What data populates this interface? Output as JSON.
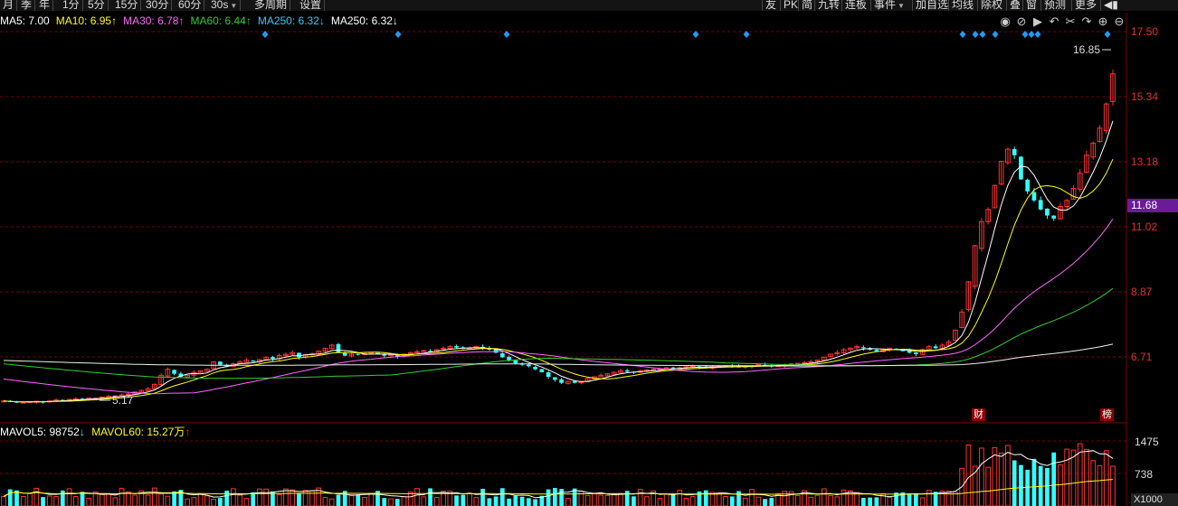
{
  "toolbar": {
    "left": [
      {
        "id": "month",
        "label": "月"
      },
      {
        "id": "quarter",
        "label": "季"
      },
      {
        "id": "year",
        "label": "年"
      },
      {
        "id": "1min",
        "label": "1分"
      },
      {
        "id": "5min",
        "label": "5分"
      },
      {
        "id": "15min",
        "label": "15分"
      },
      {
        "id": "30min",
        "label": "30分"
      },
      {
        "id": "60min",
        "label": "60分"
      },
      {
        "id": "30s",
        "label": "30s"
      },
      {
        "id": "multi-period",
        "label": "多周期"
      },
      {
        "id": "settings",
        "label": "设置"
      }
    ],
    "right": [
      {
        "id": "friend",
        "label": "友"
      },
      {
        "id": "pk",
        "label": "PK"
      },
      {
        "id": "shang",
        "label": "简"
      },
      {
        "id": "jiuzhuan",
        "label": "九转"
      },
      {
        "id": "lianban",
        "label": "连板"
      },
      {
        "id": "event",
        "label": "事件"
      },
      {
        "id": "add-watch",
        "label": "加自选"
      },
      {
        "id": "junxian",
        "label": "均线"
      },
      {
        "id": "fuquan",
        "label": "除权"
      },
      {
        "id": "dieja",
        "label": "叠"
      },
      {
        "id": "window",
        "label": "窗"
      },
      {
        "id": "forecast",
        "label": "预测"
      },
      {
        "id": "more",
        "label": "更多"
      }
    ]
  },
  "ma_legend": [
    {
      "label": "MA5: 7.00",
      "arrow": "",
      "color": "#ffffff"
    },
    {
      "label": "MA10: 6.95",
      "arrow": "↑",
      "color": "#ffff00"
    },
    {
      "label": "MA30: 6.78",
      "arrow": "↑",
      "color": "#ff66ff"
    },
    {
      "label": "MA60: 6.44",
      "arrow": "↑",
      "color": "#33cc33"
    },
    {
      "label": "MA250: 6.32",
      "arrow": "↓",
      "color": "#33ccff"
    },
    {
      "label": "MA250: 6.32",
      "arrow": "↓",
      "color": "#ffffff"
    }
  ],
  "toolbar_icons": [
    "eye-icon",
    "eye-slash-icon",
    "play-icon",
    "undo-icon",
    "scissors-icon",
    "redo-icon",
    "zoom-in-icon",
    "zoom-out-icon"
  ],
  "price_axis": [
    "17.50",
    "15.34",
    "13.18",
    "11.02",
    "8.87",
    "6.71"
  ],
  "current_price": "11.68",
  "high_label": "16.85",
  "low_label": "5.17",
  "markers": {
    "cai": "财",
    "bang": "榜"
  },
  "vol_legend": {
    "mavol5": "MAVOL5: 98752",
    "mavol5_arrow": "↓",
    "mavol60": "MAVOL60: 15.27万",
    "mavol60_arrow": "↑"
  },
  "vol_axis": [
    "1475",
    "738"
  ],
  "vol_unit": "X1000",
  "colors": {
    "up": "#ff3333",
    "down": "#33ffff",
    "grid": "#7a0000",
    "bg": "#000000"
  },
  "chart_data": {
    "type": "candlestick",
    "ylim": [
      4.9,
      17.9
    ],
    "ticks": [
      17.5,
      15.34,
      13.18,
      11.02,
      8.87,
      6.71
    ],
    "closes": [
      5.25,
      5.22,
      5.2,
      5.21,
      5.23,
      5.24,
      5.22,
      5.25,
      5.28,
      5.27,
      5.3,
      5.32,
      5.3,
      5.35,
      5.34,
      5.38,
      5.4,
      5.42,
      5.45,
      5.48,
      5.55,
      5.6,
      5.65,
      5.8,
      6.1,
      6.3,
      6.15,
      6.05,
      6.1,
      6.2,
      6.25,
      6.3,
      6.55,
      6.45,
      6.4,
      6.48,
      6.55,
      6.6,
      6.55,
      6.62,
      6.7,
      6.65,
      6.75,
      6.8,
      6.85,
      6.7,
      6.78,
      6.82,
      6.9,
      7.0,
      7.1,
      6.85,
      6.75,
      6.8,
      6.78,
      6.82,
      6.85,
      6.8,
      6.75,
      6.78,
      6.72,
      6.8,
      6.85,
      6.88,
      6.92,
      6.9,
      6.95,
      7.0,
      7.05,
      7.02,
      6.98,
      7.0,
      7.05,
      7.0,
      6.95,
      6.85,
      6.7,
      6.6,
      6.5,
      6.45,
      6.4,
      6.3,
      6.2,
      6.05,
      5.95,
      5.85,
      5.9,
      5.85,
      5.9,
      6.0,
      6.05,
      6.1,
      6.15,
      6.2,
      6.25,
      6.22,
      6.2,
      6.25,
      6.28,
      6.3,
      6.32,
      6.35,
      6.33,
      6.35,
      6.38,
      6.4,
      6.37,
      6.35,
      6.38,
      6.4,
      6.42,
      6.4,
      6.38,
      6.4,
      6.42,
      6.45,
      6.43,
      6.4,
      6.42,
      6.45,
      6.48,
      6.5,
      6.52,
      6.55,
      6.6,
      6.7,
      6.8,
      6.85,
      6.95,
      7.0,
      7.05,
      7.0,
      6.95,
      6.9,
      6.95,
      7.0,
      6.95,
      6.9,
      6.85,
      6.8,
      6.95,
      7.05,
      7.0,
      7.1,
      7.2,
      7.6,
      8.2,
      9.2,
      10.4,
      11.2,
      11.6,
      12.4,
      13.2,
      13.6,
      13.4,
      12.6,
      12.2,
      11.9,
      11.6,
      11.4,
      11.3,
      11.7,
      11.9,
      12.3,
      12.8,
      13.4,
      13.8,
      14.3,
      15.1,
      16.1
    ],
    "volume_ylim": [
      0,
      1600
    ],
    "volume_ticks": [
      1475,
      738
    ]
  }
}
